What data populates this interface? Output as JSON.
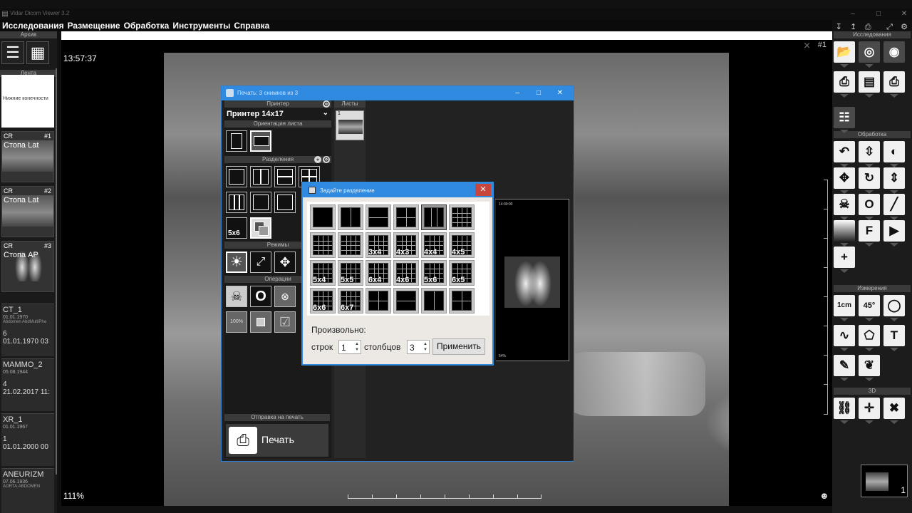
{
  "window": {
    "title": "Vidar Dicom Viewer 3.2",
    "controls": {
      "minimize": "–",
      "maximize": "□",
      "close": "✕"
    }
  },
  "menu": {
    "items": [
      "Исследования",
      "Размещение",
      "Обработка",
      "Инструменты",
      "Справка"
    ],
    "icons": [
      "download-icon",
      "upload-icon",
      "print-icon",
      "expand-icon",
      "settings-icon"
    ]
  },
  "left_panel": {
    "archive_header": "Архив",
    "tape_header": "Лента",
    "strip_note": "Нижние конечности",
    "series": [
      {
        "modality": "CR",
        "number": "#1",
        "label": "Стопа Lat"
      },
      {
        "modality": "CR",
        "number": "#2",
        "label": "Стопа Lat"
      },
      {
        "modality": "CR",
        "number": "#3",
        "label": "Стопа AP"
      }
    ],
    "studies": [
      {
        "name": "CT_1",
        "birth": "01.01.1970",
        "desc": "Abdomen AbdMultiPha",
        "count": "6",
        "date": "01.01.1970 03"
      },
      {
        "name": "MAMMO_2",
        "birth": "05.08.1944",
        "desc": "",
        "count": "4",
        "date": "21.02.2017 11:"
      },
      {
        "name": "XR_1",
        "birth": "01.01.1967",
        "desc": "",
        "count": "1",
        "date": "01.01.2000 00"
      },
      {
        "name": "ANEURIZM",
        "birth": "07.06.1936",
        "desc": "AORTA.ABDOMEN",
        "count": "",
        "date": ""
      }
    ]
  },
  "viewer": {
    "time": "13:57:37",
    "zoom": "111%",
    "slot": "#1"
  },
  "right_panel": {
    "sections": {
      "studies": "Исследования",
      "processing": "Обработка",
      "measurements": "Измерения",
      "three_d": "3D"
    },
    "study_tools": [
      {
        "name": "open-folder-icon",
        "glyph": "📂"
      },
      {
        "name": "cd-icon",
        "glyph": "◎"
      },
      {
        "name": "cd-burn-icon",
        "glyph": "◉"
      },
      {
        "name": "print-icon",
        "glyph": "⎙"
      },
      {
        "name": "save-icon",
        "glyph": "💾"
      },
      {
        "name": "print-settings-icon",
        "glyph": "⎙"
      },
      {
        "name": "anonymize-icon",
        "glyph": "☷"
      }
    ],
    "processing_tools": [
      {
        "name": "undo-icon",
        "glyph": "↶"
      },
      {
        "name": "window-level-icon",
        "glyph": "⇳"
      },
      {
        "name": "contrast-icon",
        "glyph": "◐"
      },
      {
        "name": "pan-icon",
        "glyph": "✥"
      },
      {
        "name": "rotate-icon",
        "glyph": "↻"
      },
      {
        "name": "flip-vertical-icon",
        "glyph": "⇕"
      },
      {
        "name": "skull-icon",
        "glyph": "☠"
      },
      {
        "name": "circle-roi-icon",
        "glyph": "O"
      },
      {
        "name": "line-icon",
        "glyph": "╱"
      },
      {
        "name": "gradient-icon",
        "glyph": ""
      },
      {
        "name": "filter-icon",
        "glyph": "F"
      },
      {
        "name": "cine-icon",
        "glyph": "▶"
      },
      {
        "name": "add-series-icon",
        "glyph": "+"
      }
    ],
    "measure_tools": [
      {
        "name": "ruler-icon",
        "glyph": "1cm"
      },
      {
        "name": "angle-icon",
        "glyph": "45°"
      },
      {
        "name": "ellipse-icon",
        "glyph": "◯"
      },
      {
        "name": "polyline-icon",
        "glyph": "∿"
      },
      {
        "name": "polygon-icon",
        "glyph": "⬠"
      },
      {
        "name": "text-icon",
        "glyph": "T"
      },
      {
        "name": "pipette-icon",
        "glyph": "✎"
      },
      {
        "name": "lungs-icon",
        "glyph": "❦"
      }
    ],
    "three_d_tools": [
      {
        "name": "link-icon",
        "glyph": "⛓"
      },
      {
        "name": "crosshair-icon",
        "glyph": "✛"
      },
      {
        "name": "bone-icon",
        "glyph": "✖"
      }
    ],
    "mini_count": "1"
  },
  "print_window": {
    "title": "Печать: 3 снимков из 3",
    "printer_header": "Принтер",
    "printer_value": "Принтер 14x17",
    "orientation_header": "Ориентация листа",
    "layout_header": "Разделения",
    "modes_header": "Режимы",
    "operations_header": "Операции",
    "send_header": "Отправка на печать",
    "print_label": "Печать",
    "sheets_header": "Листы",
    "sheet_number": "1",
    "layout_label": "5x6",
    "preview_time": "14:00:00",
    "preview_footer": "54%"
  },
  "divide_dialog": {
    "title": "Задайте разделение",
    "close": "✕",
    "layouts": [
      {
        "label": "",
        "type": "1x1"
      },
      {
        "label": "",
        "type": "2v"
      },
      {
        "label": "",
        "type": "2h"
      },
      {
        "label": "",
        "type": "2x2"
      },
      {
        "label": "",
        "type": "3v",
        "selected": true
      },
      {
        "label": "",
        "type": "grid"
      },
      {
        "label": "",
        "type": "grid"
      },
      {
        "label": "",
        "type": "grid"
      },
      {
        "label": "3x4",
        "type": "grid"
      },
      {
        "label": "4x3",
        "type": "grid"
      },
      {
        "label": "4x4",
        "type": "grid"
      },
      {
        "label": "4x5",
        "type": "grid"
      },
      {
        "label": "5x4",
        "type": "grid"
      },
      {
        "label": "5x5",
        "type": "grid"
      },
      {
        "label": "6x4",
        "type": "grid"
      },
      {
        "label": "4x6",
        "type": "grid"
      },
      {
        "label": "5x6",
        "type": "grid"
      },
      {
        "label": "6x5",
        "type": "grid"
      },
      {
        "label": "6x6",
        "type": "grid"
      },
      {
        "label": "6x7",
        "type": "grid"
      },
      {
        "label": "",
        "type": "2x2"
      },
      {
        "label": "",
        "type": "2h"
      },
      {
        "label": "",
        "type": "2v"
      },
      {
        "label": "",
        "type": "2x2"
      }
    ],
    "custom_label": "Произвольно:",
    "rows_label": "строк",
    "rows_value": "1",
    "cols_label": "столбцов",
    "cols_value": "3",
    "apply_label": "Применить"
  }
}
